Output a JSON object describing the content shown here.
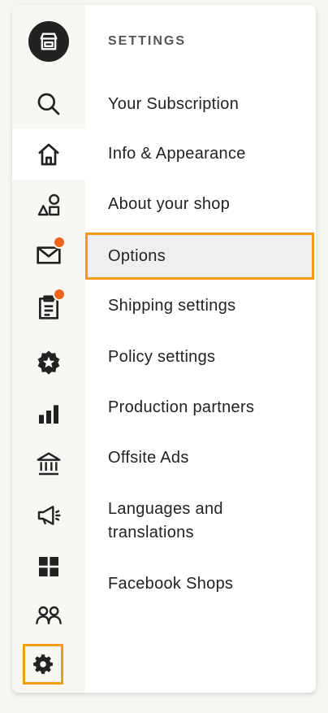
{
  "sidebar": {
    "icons": [
      {
        "name": "shop-icon"
      },
      {
        "name": "search-icon"
      },
      {
        "name": "home-icon"
      },
      {
        "name": "listings-icon"
      },
      {
        "name": "messages-icon",
        "notification": true
      },
      {
        "name": "orders-icon",
        "notification": true
      },
      {
        "name": "star-badge-icon"
      },
      {
        "name": "stats-icon"
      },
      {
        "name": "finances-icon"
      },
      {
        "name": "marketing-icon"
      },
      {
        "name": "integrations-icon"
      },
      {
        "name": "community-icon"
      },
      {
        "name": "settings-gear-icon"
      }
    ],
    "active": "home-icon",
    "highlighted": "settings-gear-icon"
  },
  "menu": {
    "title": "SETTINGS",
    "items": [
      "Your Subscription",
      "Info & Appearance",
      "About your shop",
      "Options",
      "Shipping settings",
      "Policy settings",
      "Production partners",
      "Offsite Ads",
      "Languages and\ntranslations",
      "Facebook Shops"
    ],
    "selected": "Options"
  },
  "colors": {
    "accent": "#f39c12",
    "notification": "#f1641e",
    "icon": "#222222",
    "rail_bg": "#f8f7f4"
  }
}
